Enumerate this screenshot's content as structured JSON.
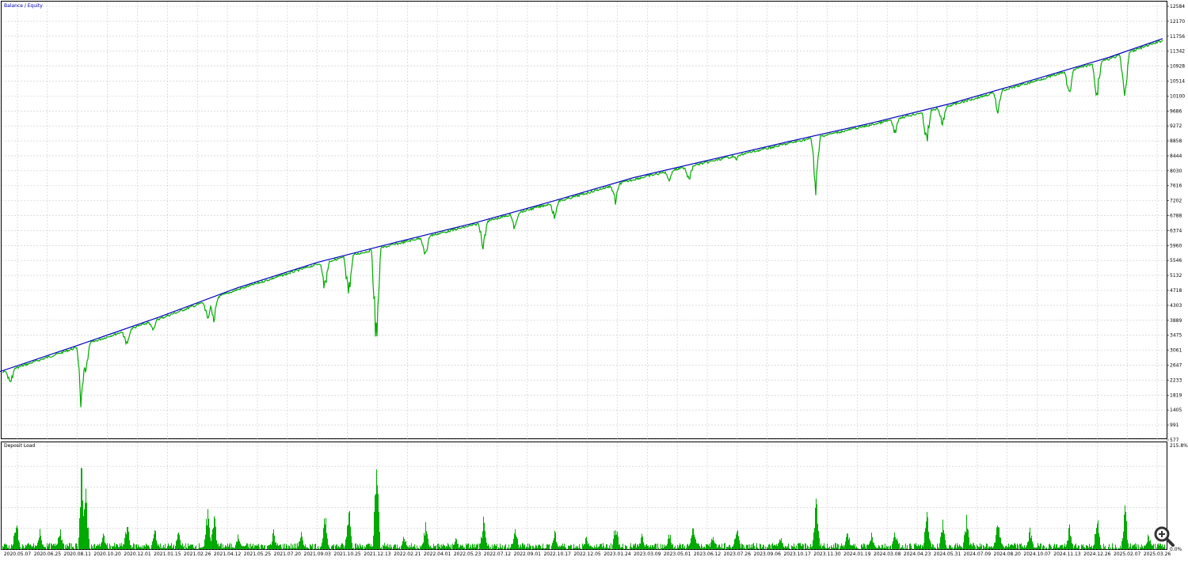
{
  "chart_data": [
    {
      "type": "line",
      "legend": "Balance / Equity",
      "series": [
        {
          "name": "Balance",
          "color": "#0000c0"
        },
        {
          "name": "Equity",
          "color": "#00aa00"
        }
      ],
      "x_ticks": [
        "2020.05.07",
        "2020.06.25",
        "2020.08.11",
        "2020.10.20",
        "2020.12.01",
        "2021.01.15",
        "2021.02.26",
        "2021.04.12",
        "2021.05.25",
        "2021.07.20",
        "2021.09.03",
        "2021.10.25",
        "2021.12.13",
        "2022.02.21",
        "2022.04.01",
        "2022.05.23",
        "2022.07.12",
        "2022.09.01",
        "2022.10.17",
        "2022.12.05",
        "2023.01.24",
        "2023.03.09",
        "2023.05.01",
        "2023.06.12",
        "2023.07.26",
        "2023.09.06",
        "2023.10.17",
        "2023.11.30",
        "2024.01.19",
        "2024.03.08",
        "2024.04.23",
        "2024.05.31",
        "2024.07.09",
        "2024.08.20",
        "2024.10.07",
        "2024.11.13",
        "2024.12.26",
        "2025.02.07",
        "2025.03.26"
      ],
      "y_ticks": [
        12584,
        12170,
        11756,
        11342,
        10928,
        10514,
        10100,
        9686,
        9272,
        8858,
        8444,
        8030,
        7616,
        7202,
        6788,
        6374,
        5960,
        5546,
        5132,
        4718,
        4303,
        3889,
        3475,
        3061,
        2647,
        2233,
        1819,
        1405,
        991,
        577
      ],
      "ylim": [
        577,
        12584
      ],
      "balance_path": [
        [
          0,
          2470
        ],
        [
          100,
          3210
        ],
        [
          200,
          3970
        ],
        [
          300,
          4790
        ],
        [
          400,
          5490
        ],
        [
          500,
          6050
        ],
        [
          600,
          6590
        ],
        [
          700,
          7200
        ],
        [
          800,
          7840
        ],
        [
          900,
          8350
        ],
        [
          1000,
          8860
        ],
        [
          1100,
          9350
        ],
        [
          1200,
          9890
        ],
        [
          1300,
          10520
        ],
        [
          1400,
          11170
        ],
        [
          1468,
          11690
        ]
      ],
      "equity_drawdowns": [
        {
          "x": 13,
          "low": 2000
        },
        {
          "x": 103,
          "low": 1000
        },
        {
          "x": 108,
          "low": 2200
        },
        {
          "x": 160,
          "low": 3050
        },
        {
          "x": 193,
          "low": 3550
        },
        {
          "x": 262,
          "low": 3750
        },
        {
          "x": 270,
          "low": 3700
        },
        {
          "x": 410,
          "low": 4600
        },
        {
          "x": 440,
          "low": 4240
        },
        {
          "x": 475,
          "low": 2700
        },
        {
          "x": 537,
          "low": 5500
        },
        {
          "x": 610,
          "low": 5760
        },
        {
          "x": 650,
          "low": 6300
        },
        {
          "x": 700,
          "low": 6650
        },
        {
          "x": 777,
          "low": 7050
        },
        {
          "x": 845,
          "low": 7720
        },
        {
          "x": 870,
          "low": 7650
        },
        {
          "x": 930,
          "low": 8320
        },
        {
          "x": 1030,
          "low": 7340
        },
        {
          "x": 1130,
          "low": 8940
        },
        {
          "x": 1170,
          "low": 8580
        },
        {
          "x": 1190,
          "low": 9150
        },
        {
          "x": 1260,
          "low": 9550
        },
        {
          "x": 1350,
          "low": 9990
        },
        {
          "x": 1385,
          "low": 9840
        },
        {
          "x": 1420,
          "low": 9750
        }
      ]
    },
    {
      "type": "area",
      "legend": "Deposit Load",
      "color": "#00aa00",
      "y_ticks": [
        "215.8%",
        "0.0%"
      ],
      "spikes": [
        {
          "x": 20,
          "v": 35
        },
        {
          "x": 50,
          "v": 20
        },
        {
          "x": 75,
          "v": 25
        },
        {
          "x": 103,
          "v": 100
        },
        {
          "x": 108,
          "v": 65
        },
        {
          "x": 130,
          "v": 18
        },
        {
          "x": 160,
          "v": 28
        },
        {
          "x": 195,
          "v": 22
        },
        {
          "x": 225,
          "v": 20
        },
        {
          "x": 262,
          "v": 50
        },
        {
          "x": 270,
          "v": 40
        },
        {
          "x": 300,
          "v": 15
        },
        {
          "x": 345,
          "v": 20
        },
        {
          "x": 380,
          "v": 18
        },
        {
          "x": 410,
          "v": 38
        },
        {
          "x": 440,
          "v": 55
        },
        {
          "x": 475,
          "v": 95
        },
        {
          "x": 510,
          "v": 15
        },
        {
          "x": 537,
          "v": 28
        },
        {
          "x": 575,
          "v": 12
        },
        {
          "x": 610,
          "v": 32
        },
        {
          "x": 650,
          "v": 25
        },
        {
          "x": 700,
          "v": 20
        },
        {
          "x": 740,
          "v": 15
        },
        {
          "x": 777,
          "v": 30
        },
        {
          "x": 810,
          "v": 15
        },
        {
          "x": 845,
          "v": 20
        },
        {
          "x": 875,
          "v": 30
        },
        {
          "x": 900,
          "v": 18
        },
        {
          "x": 930,
          "v": 32
        },
        {
          "x": 985,
          "v": 15
        },
        {
          "x": 1030,
          "v": 58
        },
        {
          "x": 1070,
          "v": 20
        },
        {
          "x": 1100,
          "v": 18
        },
        {
          "x": 1130,
          "v": 22
        },
        {
          "x": 1170,
          "v": 42
        },
        {
          "x": 1190,
          "v": 30
        },
        {
          "x": 1220,
          "v": 35
        },
        {
          "x": 1260,
          "v": 35
        },
        {
          "x": 1300,
          "v": 22
        },
        {
          "x": 1350,
          "v": 26
        },
        {
          "x": 1385,
          "v": 37
        },
        {
          "x": 1420,
          "v": 45
        },
        {
          "x": 1450,
          "v": 18
        }
      ]
    }
  ],
  "ui": {
    "zoom_icon": "magnifier-plus-icon"
  }
}
